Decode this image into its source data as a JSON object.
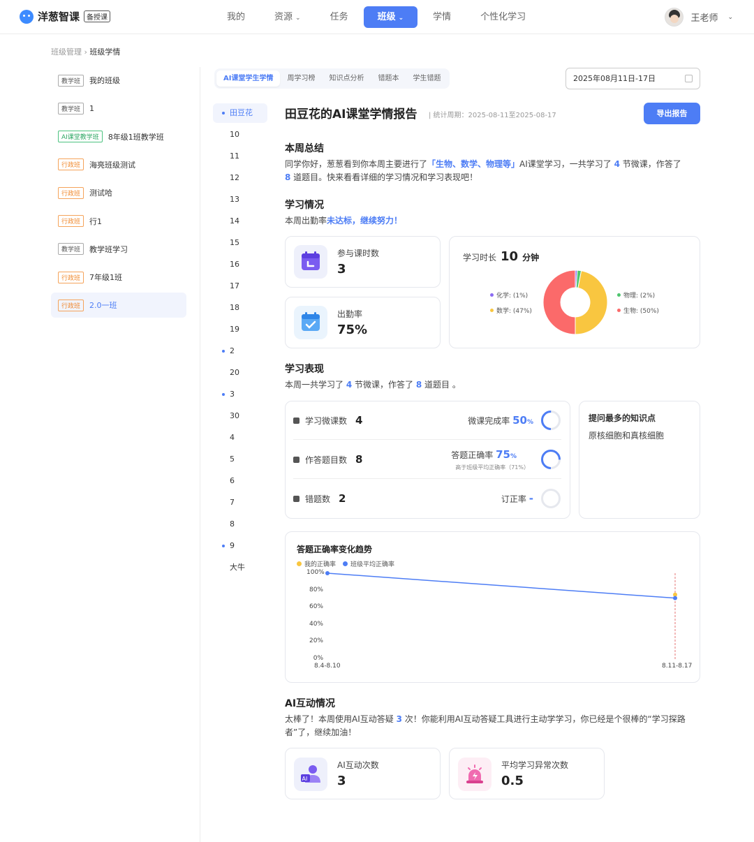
{
  "header": {
    "logo_text": "洋葱智课",
    "logo_badge": "备授课",
    "nav": [
      {
        "label": "我的",
        "dropdown": false
      },
      {
        "label": "资源",
        "dropdown": true
      },
      {
        "label": "任务",
        "dropdown": false
      },
      {
        "label": "班级",
        "dropdown": true,
        "active": true
      },
      {
        "label": "学情",
        "dropdown": false
      },
      {
        "label": "个性化学习",
        "dropdown": false
      }
    ],
    "user_name": "王老师"
  },
  "breadcrumb": {
    "parent": "班级管理",
    "sep": "›",
    "current": "班级学情"
  },
  "classes": [
    {
      "tag": "教学班",
      "tag_type": "gray",
      "name": "我的班级"
    },
    {
      "tag": "教学班",
      "tag_type": "gray",
      "name": "1"
    },
    {
      "tag": "AI课堂教学班",
      "tag_type": "green",
      "name": "8年级1班教学班"
    },
    {
      "tag": "行政班",
      "tag_type": "orange",
      "name": "海亮班级测试"
    },
    {
      "tag": "行政班",
      "tag_type": "orange",
      "name": "测试哈"
    },
    {
      "tag": "行政班",
      "tag_type": "orange",
      "name": "行1"
    },
    {
      "tag": "教学班",
      "tag_type": "gray",
      "name": "教学班学习"
    },
    {
      "tag": "行政班",
      "tag_type": "orange",
      "name": "7年级1班"
    },
    {
      "tag": "行政班",
      "tag_type": "orange",
      "name": "2.0一班",
      "selected": true
    }
  ],
  "students": [
    {
      "name": "田豆花",
      "dot": true,
      "selected": true
    },
    {
      "name": "10"
    },
    {
      "name": "11"
    },
    {
      "name": "12"
    },
    {
      "name": "13"
    },
    {
      "name": "14"
    },
    {
      "name": "15"
    },
    {
      "name": "16"
    },
    {
      "name": "17"
    },
    {
      "name": "18"
    },
    {
      "name": "19"
    },
    {
      "name": "2",
      "dot": true
    },
    {
      "name": "20"
    },
    {
      "name": "3",
      "dot": true
    },
    {
      "name": "30"
    },
    {
      "name": "4"
    },
    {
      "name": "5"
    },
    {
      "name": "6"
    },
    {
      "name": "7"
    },
    {
      "name": "8"
    },
    {
      "name": "9",
      "dot": true
    },
    {
      "name": "大牛"
    }
  ],
  "tabs": [
    "AI课堂学生学情",
    "周学习榜",
    "知识点分析",
    "错题本",
    "学生错题"
  ],
  "date_range": "2025年08月11日-17日",
  "report": {
    "title": "田豆花的AI课堂学情报告",
    "period": "| 统计周期：2025-08-11至2025-08-17",
    "export_label": "导出报告",
    "summary_heading": "本周总结",
    "summary_1a": "同学你好，葱葱看到你本周主要进行了",
    "summary_subjects": "「生物、数学、物理等」",
    "summary_1b": "AI课堂学习，一共学习了 ",
    "summary_lessons": "4",
    "summary_1c": " 节微课，作答了",
    "summary_questions": "8",
    "summary_2": " 道题目。快来看看详细的学习情况和学习表现吧！",
    "study_heading": "学习情况",
    "attendance_note_a": "本周出勤率",
    "attendance_note_b": "未达标，继续努力！",
    "lesson_count_label": "参与课时数",
    "lesson_count_value": "3",
    "attendance_label": "出勤率",
    "attendance_value": "75%",
    "duration_label": "学习时长",
    "duration_value": "10",
    "duration_unit": "分钟",
    "perf_heading": "学习表现",
    "perf_note_a": "本周一共学习了 ",
    "perf_note_lessons": "4",
    "perf_note_b": " 节微课，作答了 ",
    "perf_note_questions": "8",
    "perf_note_c": " 道题目 。",
    "micro_label": "学习微课数",
    "micro_value": "4",
    "micro_rate_label": "微课完成率",
    "micro_rate_value": "50",
    "micro_rate_unit": "%",
    "answer_label": "作答题目数",
    "answer_value": "8",
    "answer_rate_label": "答题正确率",
    "answer_rate_value": "75",
    "answer_rate_unit": "%",
    "answer_rate_note": "高于班级平均正确率（71%）",
    "wrong_label": "错题数",
    "wrong_value": "2",
    "fix_rate_label": "订正率",
    "fix_rate_value": "-",
    "knowledge_heading": "提问最多的知识点",
    "knowledge_value": "原核细胞和真核细胞",
    "ai_heading": "AI互动情况",
    "ai_note_a": "太棒了！本周使用AI互动答疑 ",
    "ai_note_count": "3",
    "ai_note_b": " 次！你能利用AI互动答疑工具进行主动学学习，你已经是个很棒的“学习探路",
    "ai_note_c": "者”了，继续加油！",
    "ai_count_label": "AI互动次数",
    "ai_count_value": "3",
    "anomaly_label": "平均学习异常次数",
    "anomaly_value": "0.5"
  },
  "progress": {
    "micro_completion": 0.5,
    "answer_accuracy": 0.75,
    "fix_rate": 0
  },
  "colors": {
    "accent": "#4d7df5",
    "yellow": "#f9c640",
    "red": "#fb6a6a",
    "green": "#4fc56f",
    "violet": "#8b6cf2"
  },
  "chart_data": [
    {
      "type": "pie",
      "style": "donut",
      "slices": [
        {
          "name": "化学",
          "label": "化学: (1%)",
          "value": 1,
          "color": "#8b6cf2"
        },
        {
          "name": "物理",
          "label": "物理: (2%)",
          "value": 2,
          "color": "#4fc56f"
        },
        {
          "name": "数学",
          "label": "数学: (47%)",
          "value": 47,
          "color": "#f9c640"
        },
        {
          "name": "生物",
          "label": "生物: (50%)",
          "value": 50,
          "color": "#fb6a6a"
        }
      ]
    },
    {
      "type": "line",
      "title": "答题正确率变化趋势",
      "categories": [
        "8.4-8.10",
        "8.11-8.17"
      ],
      "series": [
        {
          "name": "我的正确率",
          "color": "#f9c640",
          "values": [
            null,
            75
          ]
        },
        {
          "name": "班级平均正确率",
          "color": "#4d7df5",
          "values": [
            100,
            71
          ]
        }
      ],
      "yticks": [
        "100%",
        "80%",
        "60%",
        "40%",
        "20%",
        "0%"
      ],
      "ylim": [
        0,
        100
      ],
      "legend": "top-left"
    }
  ]
}
